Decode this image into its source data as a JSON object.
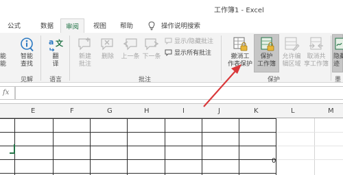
{
  "window": {
    "title": "工作簿1  -  Excel"
  },
  "tabs": [
    {
      "label": "公式"
    },
    {
      "label": "数据"
    },
    {
      "label": "审阅"
    },
    {
      "label": "视图"
    },
    {
      "label": "帮助"
    }
  ],
  "tell_me": {
    "label": "操作说明搜索"
  },
  "ribbon": {
    "left_cut": {
      "line1": "能",
      "line2": "能"
    },
    "insights": {
      "line1": "智能",
      "line2": "查找",
      "group": "见解"
    },
    "translate": {
      "line1": "翻",
      "line2": "译",
      "group": "语言"
    },
    "comments": {
      "new": {
        "line1": "新建",
        "line2": "批注"
      },
      "delete": {
        "label": "删除"
      },
      "prev": {
        "label": "上一条"
      },
      "next": {
        "label": "下一条"
      },
      "show_hide": {
        "label": "显示/隐藏批注"
      },
      "show_all": {
        "label": "显示所有批注"
      },
      "group": "批注"
    },
    "protect": {
      "unprotect_sheet": {
        "line1": "撤消工",
        "line2": "作表保护"
      },
      "protect_workbook": {
        "line1": "保护",
        "line2": "工作簿"
      },
      "allow_edit": {
        "line1": "允许编",
        "line2": "辑区域"
      },
      "unshare": {
        "line1": "取消共",
        "line2": "享工作簿"
      },
      "group": "保护"
    },
    "right_cut": {
      "line1": "隐藏",
      "line2": "迹",
      "group": "墨"
    }
  },
  "formula_bar": {
    "fx": "fx",
    "value": ""
  },
  "columns": [
    "E",
    "F",
    "G",
    "H",
    "I",
    "J",
    "K",
    "L",
    "M"
  ],
  "cells": {
    "k_value": "0"
  },
  "colors": {
    "accent": "#217346",
    "arrow": "#d9383a",
    "ribbon_bg": "#f3f3f3"
  }
}
